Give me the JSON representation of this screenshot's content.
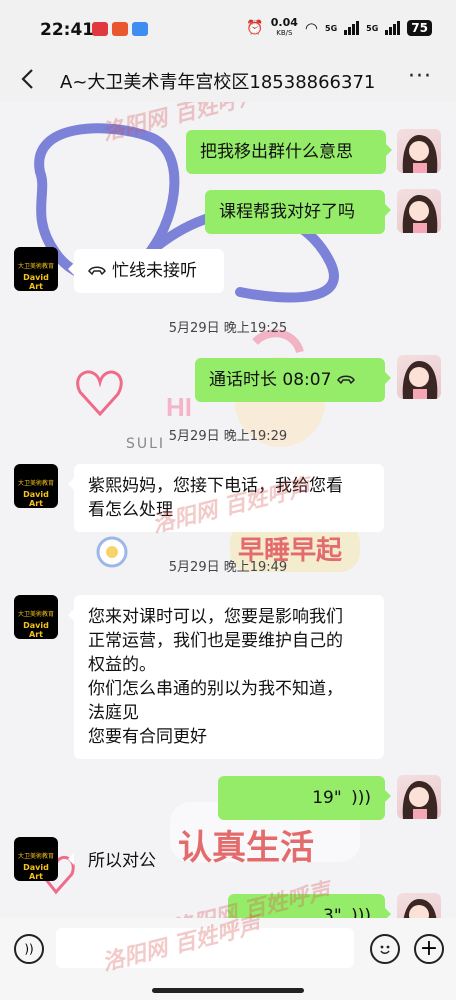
{
  "status_bar": {
    "time": "22:41",
    "net_speed": "0.04",
    "net_unit": "KB/S",
    "signal1": "5G",
    "signal2": "5G",
    "battery": "75"
  },
  "header": {
    "title": "A~大卫美术青年宫校区18538866371"
  },
  "messages": [
    {
      "sender": "me",
      "text": "把我移出群什么意思"
    },
    {
      "sender": "me",
      "text": "课程帮我对好了吗"
    },
    {
      "sender": "school",
      "text": "忙线未接听"
    },
    {
      "type": "time",
      "text": "5月29日 晚上19:25"
    },
    {
      "sender": "me",
      "text": "通话时长 08:07"
    },
    {
      "type": "time",
      "text": "5月29日 晚上19:29"
    },
    {
      "sender": "school",
      "text_lines": [
        "紫熙妈妈，您接下电话，我给您看",
        "看怎么处理"
      ]
    },
    {
      "type": "time",
      "text": "5月29日 晚上19:49"
    },
    {
      "sender": "school",
      "text_lines": [
        "您来对课时可以，您要是影响我们",
        "正常运营，我们也是要维护自己的",
        "权益的。",
        "你们怎么串通的别以为我不知道，",
        "法庭见",
        "您要有合同更好"
      ]
    },
    {
      "sender": "me",
      "text": "19\""
    },
    {
      "sender": "school",
      "text": "所以对公"
    },
    {
      "sender": "me",
      "text": "3\""
    }
  ],
  "background_text": {
    "hi": "HI",
    "suli": "SULI",
    "zao_shui": "早睡早起",
    "ren_zhen": "认真生活"
  },
  "watermark": {
    "text": "洛阳网 百姓呼声"
  },
  "avatar_text": {
    "school_main": "大卫美術教育",
    "school_sub": "David Art"
  },
  "colors": {
    "my_bubble": "#95ec69",
    "their_bubble": "#ffffff",
    "background": "#f3f3f6"
  },
  "icons": [
    "back-arrow-icon",
    "more-icon",
    "phone-hangup-icon",
    "voice-wave-icon",
    "voice-input-icon",
    "emoji-icon",
    "plus-icon"
  ]
}
